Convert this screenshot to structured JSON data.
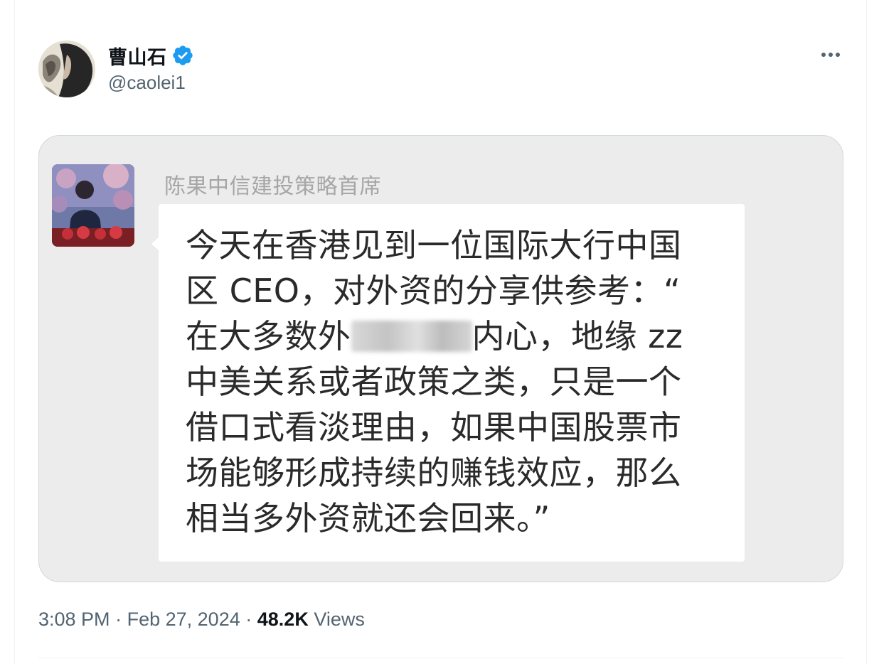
{
  "tweet": {
    "author": {
      "name": "曹山石",
      "handle": "@caolei1",
      "verified": true,
      "verified_color": "#1d9bf0"
    },
    "more_icon": "more-horizontal-icon",
    "media": {
      "sender_name": "陈果中信建投策略首席",
      "message_lines": [
        "今天在香港见到一位国际大行中国",
        "区 CEO，对外资的分享供参考：“",
        "在大多数外",
        "内心，地缘 zz",
        "中美关系或者政策之类，只是一个",
        "借口式看淡理由，如果中国股票市",
        "场能够形成持续的赚钱效应，那么",
        "相当多外资就还会回来。”"
      ]
    },
    "meta": {
      "time": "3:08 PM",
      "separator": "·",
      "date": "Feb 27, 2024",
      "views_count": "48.2K",
      "views_label": "Views"
    }
  },
  "colors": {
    "text_primary": "#0f1419",
    "text_secondary": "#536471",
    "border": "#cfd9de",
    "screenshot_bg": "#ececec"
  }
}
